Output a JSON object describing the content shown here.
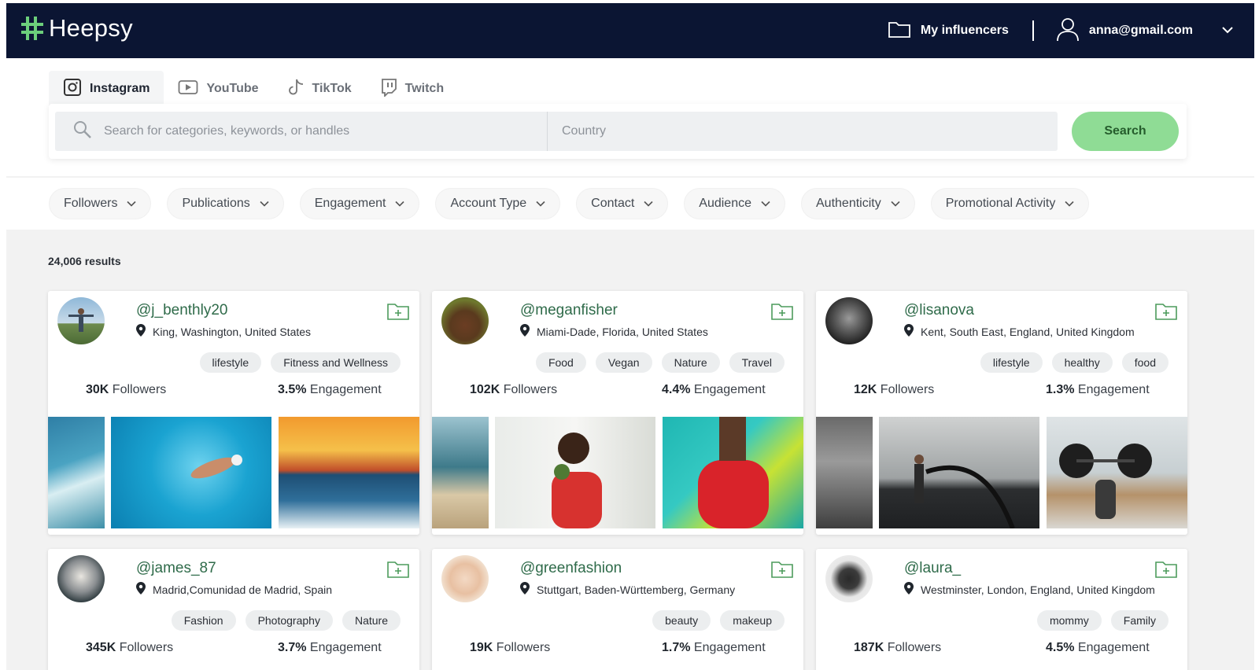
{
  "brand": {
    "name": "Heepsy"
  },
  "header": {
    "my_influencers": "My influencers",
    "user_email": "anna@gmail.com"
  },
  "tabs": [
    {
      "label": "Instagram",
      "icon": "instagram-icon",
      "active": true
    },
    {
      "label": "YouTube",
      "icon": "youtube-icon",
      "active": false
    },
    {
      "label": "TikTok",
      "icon": "tiktok-icon",
      "active": false
    },
    {
      "label": "Twitch",
      "icon": "twitch-icon",
      "active": false
    }
  ],
  "search": {
    "keyword_placeholder": "Search for categories, keywords, or handles",
    "country_placeholder": "Country",
    "button": "Search"
  },
  "filters": [
    "Followers",
    "Publications",
    "Engagement",
    "Account Type",
    "Contact",
    "Audience",
    "Authenticity",
    "Promotional Activity"
  ],
  "results_count": "24,006 results",
  "colors": {
    "header_bg": "#0b1533",
    "accent_green": "#8fdc95",
    "handle_green": "#2f6b4a"
  },
  "cards": [
    {
      "handle": "@j_benthly20",
      "location": "King, Washington, United States",
      "tags": [
        "lifestyle",
        "Fitness and Wellness"
      ],
      "followers_value": "30K",
      "followers_label": " Followers",
      "engagement_value": "3.5%",
      "engagement_label": " Engagement"
    },
    {
      "handle": "@meganfisher",
      "location": "Miami-Dade, Florida, United States",
      "tags": [
        "Food",
        "Vegan",
        "Nature",
        "Travel"
      ],
      "followers_value": "102K",
      "followers_label": " Followers",
      "engagement_value": "4.4%",
      "engagement_label": " Engagement"
    },
    {
      "handle": "@lisanova",
      "location": "Kent, South East, England, United Kingdom",
      "tags": [
        "lifestyle",
        "healthy",
        "food"
      ],
      "followers_value": "12K",
      "followers_label": " Followers",
      "engagement_value": "1.3%",
      "engagement_label": " Engagement"
    },
    {
      "handle": "@james_87",
      "location": "Madrid,Comunidad de Madrid, Spain",
      "tags": [
        "Fashion",
        "Photography",
        "Nature"
      ],
      "followers_value": "345K",
      "followers_label": " Followers",
      "engagement_value": "3.7%",
      "engagement_label": " Engagement"
    },
    {
      "handle": "@greenfashion",
      "location": "Stuttgart, Baden-Württemberg, Germany",
      "tags": [
        "beauty",
        "makeup"
      ],
      "followers_value": "19K",
      "followers_label": " Followers",
      "engagement_value": "1.7%",
      "engagement_label": " Engagement"
    },
    {
      "handle": "@laura_",
      "location": "Westminster, London, England, United Kingdom",
      "tags": [
        "mommy",
        "Family"
      ],
      "followers_value": "187K",
      "followers_label": " Followers",
      "engagement_value": "4.5%",
      "engagement_label": " Engagement"
    }
  ]
}
